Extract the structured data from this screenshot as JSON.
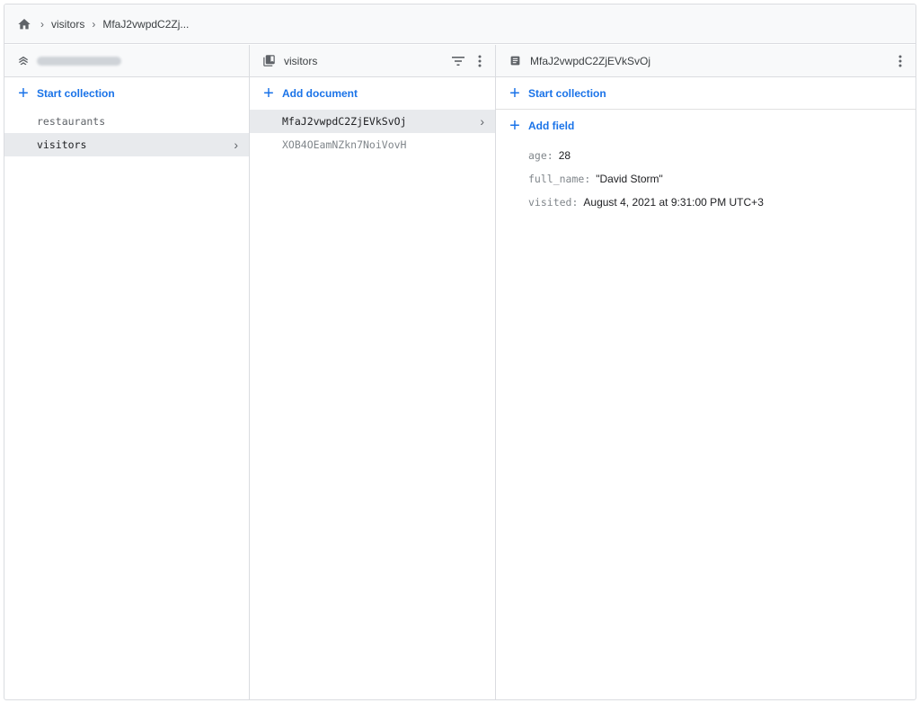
{
  "breadcrumb": {
    "home_icon": "home-icon",
    "items": [
      "visitors",
      "MfaJ2vwpdC2Zj..."
    ]
  },
  "columns": {
    "root": {
      "header_icon": "database-icon",
      "start_collection_label": "Start collection",
      "items": [
        {
          "label": "restaurants",
          "selected": false
        },
        {
          "label": "visitors",
          "selected": true
        }
      ]
    },
    "collection": {
      "header_icon": "collection-icon",
      "title": "visitors",
      "add_document_label": "Add document",
      "items": [
        {
          "label": "MfaJ2vwpdC2ZjEVkSvOj",
          "selected": true
        },
        {
          "label": "XOB4OEamNZkn7NoiVovH",
          "selected": false
        }
      ]
    },
    "document": {
      "header_icon": "document-icon",
      "title": "MfaJ2vwpdC2ZjEVkSvOj",
      "start_collection_label": "Start collection",
      "add_field_label": "Add field",
      "fields": [
        {
          "key": "age",
          "value": "28"
        },
        {
          "key": "full_name",
          "value": "\"David Storm\""
        },
        {
          "key": "visited",
          "value": "August 4, 2021 at 9:31:00 PM UTC+3"
        }
      ]
    }
  },
  "colors": {
    "accent": "#1a73e8",
    "header_bg": "#f8f9fa",
    "selected_bg": "#e8eaed",
    "border": "#dadce0"
  }
}
